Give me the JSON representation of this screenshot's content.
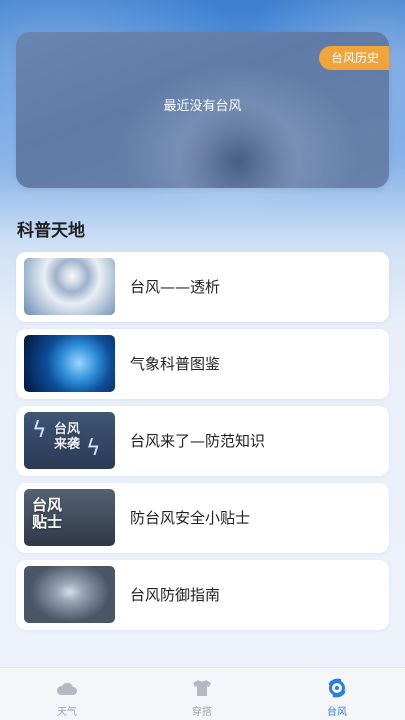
{
  "banner": {
    "empty_text": "最近没有台风",
    "history_label": "台风历史"
  },
  "section": {
    "title": "科普天地"
  },
  "articles": [
    {
      "title": "台风——透析",
      "thumb_icon": "typhoon-satellite-thumb"
    },
    {
      "title": "气象科普图鉴",
      "thumb_icon": "earth-thumb"
    },
    {
      "title": "台风来了—防范知识",
      "thumb_icon": "lightning-thumb",
      "thumb_text": "台风\n来袭"
    },
    {
      "title": "防台风安全小贴士",
      "thumb_icon": "tips-thumb",
      "thumb_text": "台风\n贴士"
    },
    {
      "title": "台风防御指南",
      "thumb_icon": "tornado-thumb"
    }
  ],
  "tabs": [
    {
      "label": "天气",
      "icon": "cloud-icon",
      "active": false
    },
    {
      "label": "穿搭",
      "icon": "shirt-icon",
      "active": false
    },
    {
      "label": "台风",
      "icon": "typhoon-icon",
      "active": true
    }
  ],
  "colors": {
    "accent": "#2a7de1",
    "history_badge": "#f0a43a",
    "tab_inactive": "#9aa3ad"
  }
}
